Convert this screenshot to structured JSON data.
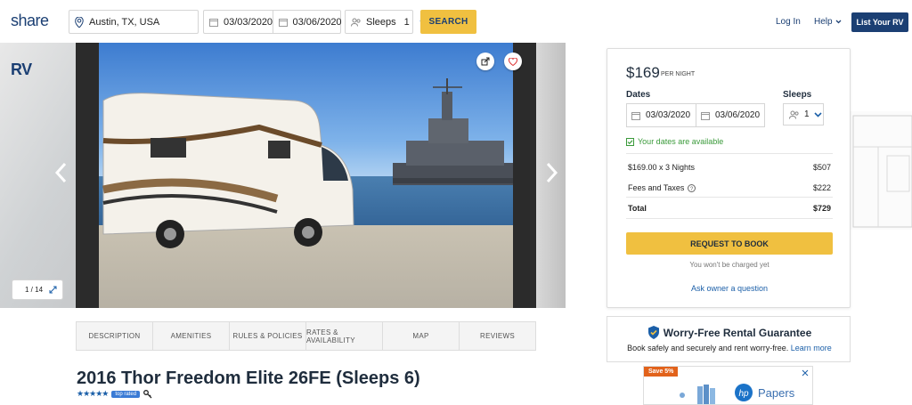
{
  "brand": {
    "logo_part1": "RV",
    "logo_part2": "share",
    "accent": "#f0c040",
    "primary": "#1b3f73"
  },
  "search": {
    "location": "Austin, TX, USA",
    "start_date": "03/03/2020",
    "end_date": "03/06/2020",
    "sleeps_label": "Sleeps",
    "sleeps_value": "1",
    "button": "SEARCH"
  },
  "nav": {
    "login": "Log In",
    "help": "Help",
    "list_rv": "List Your RV"
  },
  "gallery": {
    "counter": "1 / 14"
  },
  "tabs": [
    "DESCRIPTION",
    "AMENITIES",
    "RULES & POLICIES",
    "RATES & AVAILABILITY",
    "MAP",
    "REVIEWS"
  ],
  "listing": {
    "title": "2016 Thor Freedom Elite 26FE (Sleeps 6)",
    "stars": "★★★★★",
    "badge": "top rated"
  },
  "booking": {
    "price": "$169",
    "per_night": "PER NIGHT",
    "dates_label": "Dates",
    "sleeps_label": "Sleeps",
    "start_date": "03/03/2020",
    "end_date": "03/06/2020",
    "sleeps_value": "1",
    "availability": "Your dates are available",
    "rows": [
      {
        "label": "$169.00 x 3 Nights",
        "value": "$507"
      },
      {
        "label": "Fees and Taxes",
        "value": "$222"
      },
      {
        "label": "Total",
        "value": "$729"
      }
    ],
    "request_button": "REQUEST TO BOOK",
    "not_charged": "You won't be charged yet",
    "ask_owner": "Ask owner a question"
  },
  "guarantee": {
    "title": "Worry-Free Rental Guarantee",
    "subtitle": "Book safely and securely and rent worry-free.",
    "link": "Learn more"
  },
  "ad": {
    "save": "Save 5%",
    "brand": "Papers",
    "logo": "hp"
  }
}
